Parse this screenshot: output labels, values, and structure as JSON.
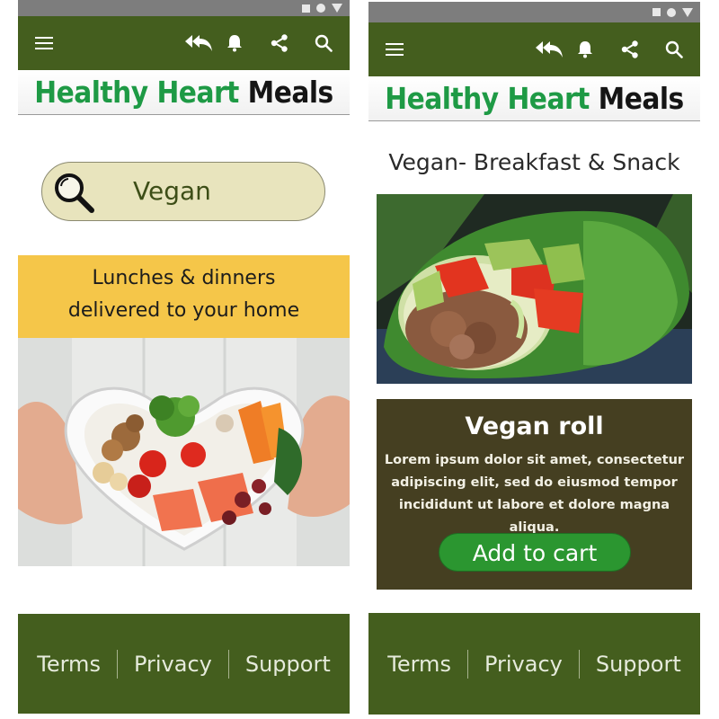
{
  "brand": {
    "green_part": "Healthy Heart",
    "dark_part": "Meals"
  },
  "left_screen": {
    "search": {
      "value": "Vegan"
    },
    "promo": {
      "line1": "Lunches & dinners",
      "line2": "delivered to your home"
    }
  },
  "right_screen": {
    "page_title": "Vegan- Breakfast & Snack",
    "card": {
      "title": "Vegan roll",
      "description": "Lorem ipsum dolor sit amet, consectetur adipiscing elit, sed do eiusmod tempor incididunt ut labore et dolore magna aliqua.",
      "button_label": "Add to  cart"
    }
  },
  "footer": {
    "terms": "Terms",
    "privacy": "Privacy",
    "support": "Support"
  },
  "icons": [
    "hamburger-icon",
    "reply-all-icon",
    "bell-icon",
    "share-icon",
    "search-icon"
  ],
  "colors": {
    "appbar": "#445e1e",
    "brand_green": "#1e9a45",
    "promo": "#f5c649",
    "card": "#453f21",
    "button": "#2b9630",
    "search_pill": "#e8e4bd"
  }
}
